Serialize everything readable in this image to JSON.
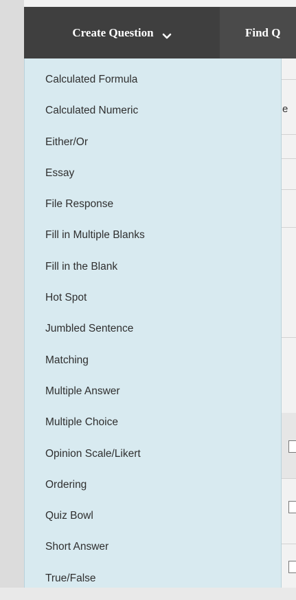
{
  "toolbar": {
    "create_question_label": "Create Question",
    "find_questions_label": "Find Q"
  },
  "menu": {
    "items": [
      "Calculated Formula",
      "Calculated Numeric",
      "Either/Or",
      "Essay",
      "File Response",
      "Fill in Multiple Blanks",
      "Fill in the Blank",
      "Hot Spot",
      "Jumbled Sentence",
      "Matching",
      "Multiple Answer",
      "Multiple Choice",
      "Opinion Scale/Likert",
      "Ordering",
      "Quiz Bowl",
      "Short Answer",
      "True/False"
    ]
  },
  "background": {
    "fragment_text": "e"
  },
  "colors": {
    "toolbar_bg": "#4a4a4a",
    "menu_bg": "#d8eaf0",
    "menu_text": "#2f2f2f"
  },
  "icons": {
    "dropdown": "chevron-down-icon"
  }
}
